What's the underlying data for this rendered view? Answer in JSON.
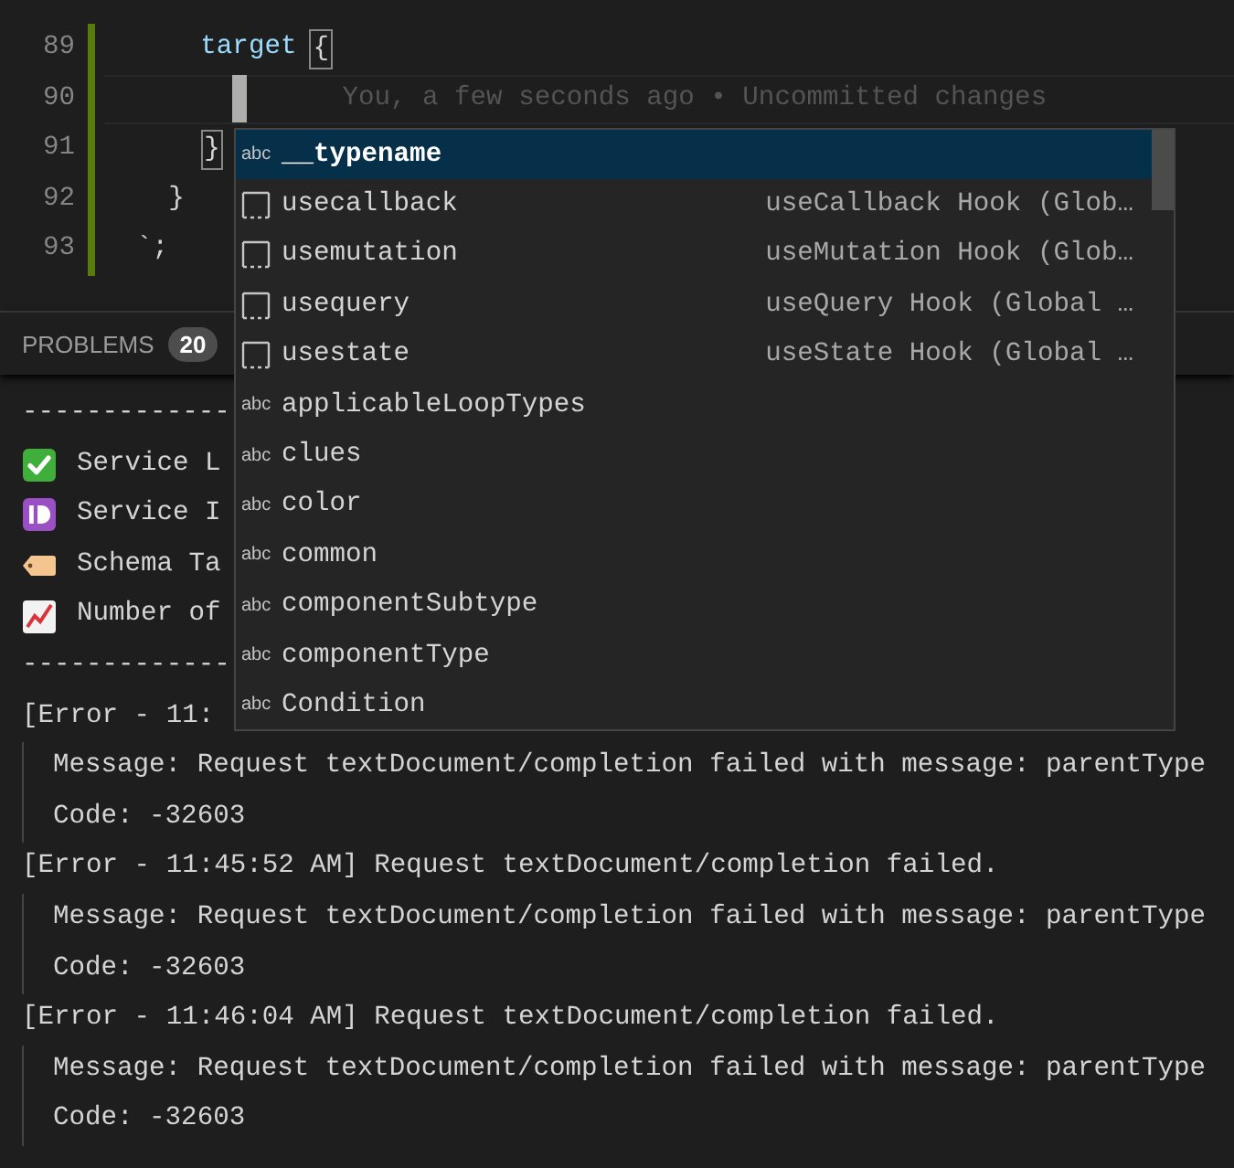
{
  "editor": {
    "lines": [
      {
        "children": [
          {
            "children": [
              {
                "children": [
                  {
                    "number": "89",
                    "changed": true,
                    "tokens": [
                      {
                        "kind": "property",
                        "text": "target"
                      },
                      {
                        "kind": "bracket-match",
                        "text": "{"
                      }
                    ]
                  },
                  {
                    "children": [
                      {
                        "number": "90",
                        "changed": true,
                        "current": true,
                        "cursor": true,
                        "tokens": [
                          {
                            "kind": "blame",
                            "text": "You, a few seconds ago • Uncommitted changes"
                          }
                        ]
                      }
                    ]
                  },
                  {
                    "number": "91",
                    "changed": true,
                    "tokens": [
                      {
                        "kind": "bracket-match",
                        "text": "}"
                      }
                    ]
                  }
                ]
              },
              {
                "number": "92",
                "changed": true,
                "tokens": [
                  {
                    "kind": "punct",
                    "text": "}"
                  }
                ]
              }
            ]
          },
          {
            "number": "93",
            "changed": true,
            "tokens": [
              {
                "kind": "punct",
                "text": "`;"
              }
            ]
          }
        ]
      }
    ]
  },
  "panel": {
    "tabs": [
      {
        "label": "PROBLEMS",
        "badge": "20"
      }
    ],
    "output": [
      {
        "kind": "rule",
        "text": "-------------"
      },
      {
        "kind": "status",
        "text": "Service L"
      },
      {
        "kind": "status",
        "text": "Service I"
      },
      {
        "kind": "status",
        "text": "Schema Ta"
      },
      {
        "kind": "status",
        "text": "Number of"
      },
      {
        "kind": "rule",
        "text": "-------------"
      },
      {
        "kind": "error",
        "text": "[Error - 11:",
        "details": [
          "Message: Request textDocument/completion failed with message: parentType",
          "Code: -32603"
        ]
      },
      {
        "kind": "error",
        "text": "[Error - 11:45:52 AM] Request textDocument/completion failed.",
        "details": [
          "Message: Request textDocument/completion failed with message: parentType",
          "Code: -32603"
        ]
      },
      {
        "kind": "error",
        "text": "[Error - 11:46:04 AM] Request textDocument/completion failed.",
        "details": [
          "Message: Request textDocument/completion failed with message: parentType",
          "Code: -32603"
        ]
      }
    ]
  },
  "suggestions": [
    {
      "kind": "word",
      "icon_text": "abc",
      "label": "__typename",
      "selected": true
    },
    {
      "kind": "snippet",
      "label": "usecallback",
      "detail": "useCallback Hook (Glob…",
      "selected": false
    },
    {
      "kind": "snippet",
      "label": "usemutation",
      "detail": "useMutation Hook (Glob…",
      "selected": false
    },
    {
      "kind": "snippet",
      "label": "usequery",
      "detail": "useQuery Hook (Global …",
      "selected": false
    },
    {
      "kind": "snippet",
      "label": "usestate",
      "detail": "useState Hook (Global …",
      "selected": false
    },
    {
      "kind": "word",
      "icon_text": "abc",
      "label": "applicableLoopTypes",
      "selected": false
    },
    {
      "kind": "word",
      "icon_text": "abc",
      "label": "clues",
      "selected": false
    },
    {
      "kind": "word",
      "icon_text": "abc",
      "label": "color",
      "selected": false
    },
    {
      "kind": "word",
      "icon_text": "abc",
      "label": "common",
      "selected": false
    },
    {
      "kind": "word",
      "icon_text": "abc",
      "label": "componentSubtype",
      "selected": false
    },
    {
      "kind": "word",
      "icon_text": "abc",
      "label": "componentType",
      "selected": false
    },
    {
      "kind": "word",
      "icon_text": "abc",
      "label": "Condition",
      "selected": false
    }
  ]
}
